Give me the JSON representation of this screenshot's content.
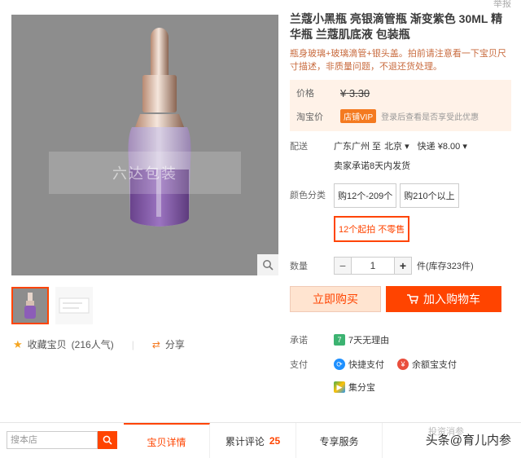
{
  "top_tag": "举报",
  "product": {
    "title": "兰蔻小黑瓶 亮银滴管瓶 渐变紫色 30ML 精华瓶 兰蔻肌底液 包装瓶",
    "subtitle": "瓶身玻璃+玻璃滴管+银头盖。拍前请注意看一下宝贝尺寸描述，非质量问题，不退还货处理。",
    "watermark": "六达包装"
  },
  "price": {
    "label": "价格",
    "currency": "¥",
    "old_value": "3.30",
    "taobao_label": "淘宝价",
    "vip_badge": "店铺VIP",
    "vip_text": "登录后查看是否享受此优惠"
  },
  "shipping": {
    "label": "配送",
    "from": "广东广州 至",
    "to": "北京",
    "method": "快递 ¥8.00",
    "promise": "卖家承诺8天内发货"
  },
  "sku": {
    "label": "颜色分类",
    "options": [
      "购12个-209个",
      "购210个以上",
      "12个起拍 不零售"
    ]
  },
  "quantity": {
    "label": "数量",
    "minus": "−",
    "value": "1",
    "plus": "+",
    "stock": "件(库存323件)"
  },
  "actions": {
    "buy_now": "立即购买",
    "add_cart": "加入购物车"
  },
  "service": {
    "promise_label": "承诺",
    "promise_value": "7天无理由",
    "promise_icon_text": "7",
    "pay_label": "支付",
    "pay_methods": [
      "快捷支付",
      "余额宝支付",
      "集分宝"
    ]
  },
  "favorites": {
    "collect": "收藏宝贝",
    "count": "(216人气)",
    "share": "分享"
  },
  "bottom": {
    "search_placeholder": "搜本店",
    "tabs": [
      {
        "label": "宝贝详情",
        "count": ""
      },
      {
        "label": "累计评论",
        "count": "25"
      },
      {
        "label": "专享服务",
        "count": ""
      }
    ],
    "watermark": "头条@育儿内参",
    "watermark_faint": "投资消参"
  },
  "colors": {
    "accent": "#ff4400",
    "price_bg": "#fff2e8"
  }
}
